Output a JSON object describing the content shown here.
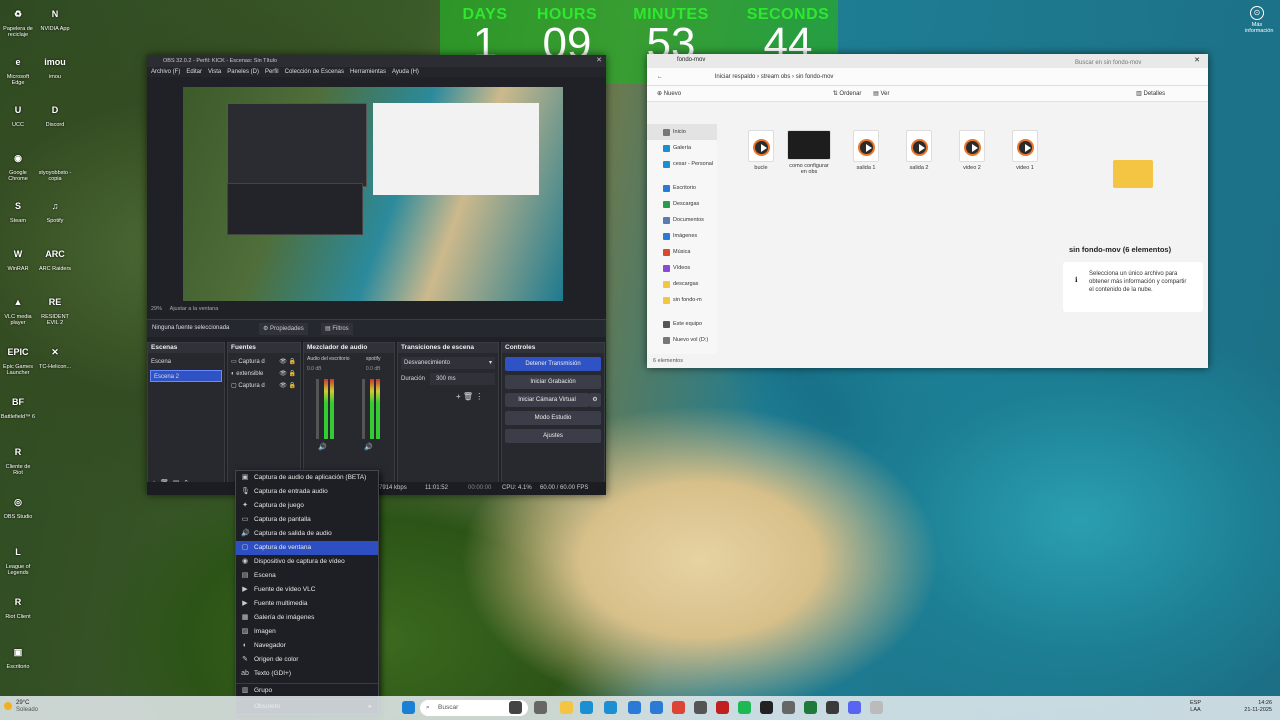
{
  "desktop": {
    "icons": [
      {
        "label": "Papelera de reciclaje",
        "glyph": "♻",
        "color": "#4a90d9"
      },
      {
        "label": "NVIDIA App",
        "glyph": "N",
        "color": "#6bb82d"
      },
      {
        "label": "Microsoft Edge",
        "glyph": "e",
        "color": "#1b8fd2"
      },
      {
        "label": "imou",
        "glyph": "imou",
        "color": "#f39a1e"
      },
      {
        "label": "UCC",
        "glyph": "U",
        "color": "#e05a1c"
      },
      {
        "label": "Discord",
        "glyph": "D",
        "color": "#5865f2"
      },
      {
        "label": "Google Chrome",
        "glyph": "◉",
        "color": "#db4437"
      },
      {
        "label": "styoyobbsto - copia",
        "glyph": "",
        "color": "#f2f2f2"
      },
      {
        "label": "Steam",
        "glyph": "S",
        "color": "#1b2838"
      },
      {
        "label": "Spotify",
        "glyph": "♫",
        "color": "#1db954"
      },
      {
        "label": "WinRAR",
        "glyph": "W",
        "color": "#8a2d8a"
      },
      {
        "label": "ARC Raiders",
        "glyph": "ARC",
        "color": "#222222"
      },
      {
        "label": "VLC media player",
        "glyph": "▲",
        "color": "#f08a00"
      },
      {
        "label": "RESIDENT EVIL 2",
        "glyph": "RE",
        "color": "#3a0d0d"
      },
      {
        "label": "Epic Games Launcher",
        "glyph": "EPIC",
        "color": "#2a2a2a"
      },
      {
        "label": "TC-Helicon...",
        "glyph": "✕",
        "color": "#111111"
      },
      {
        "label": "Battlefield™ 6",
        "glyph": "BF",
        "color": "#8a4a2a"
      },
      {
        "label": "Cliente de Riot",
        "glyph": "R",
        "color": "#d13639"
      },
      {
        "label": "OBS Studio",
        "glyph": "◎",
        "color": "#302e31"
      },
      {
        "label": "League of Legends",
        "glyph": "L",
        "color": "#c89b3c"
      },
      {
        "label": "Riot Client",
        "glyph": "R",
        "color": "#d13639"
      },
      {
        "label": "Escritorio",
        "glyph": "▣",
        "color": "#5a7ab0"
      }
    ],
    "top_right_icon_label": "Más información"
  },
  "timer": {
    "labels": [
      "DAYS",
      "HOURS",
      "MINUTES",
      "SECONDS"
    ],
    "values": [
      "1",
      "09",
      "53",
      "44"
    ]
  },
  "obs": {
    "title": "OBS 32.0.2 - Perfil: KICK - Escenas: Sin Título",
    "menu": [
      "Archivo (F)",
      "Editar",
      "Vista",
      "Paneles (D)",
      "Perfil",
      "Colección de Escenas",
      "Herramientas",
      "Ayuda (H)"
    ],
    "zoom_label": "29%",
    "fit_label": "Ajustar a la ventana",
    "no_source": "Ninguna fuente seleccionada",
    "properties_btn": "Propiedades",
    "filters_btn": "Filtros",
    "panels": {
      "scenes": {
        "title": "Escenas",
        "items": [
          "Escena",
          "Escena 2"
        ],
        "selected": 1
      },
      "sources": {
        "title": "Fuentes",
        "items": [
          "Captura d",
          "extensible",
          "Captura d"
        ]
      },
      "mixer": {
        "title": "Mezclador de audio",
        "channels": [
          {
            "name": "Audio del escritorio",
            "db": "0.0 dB"
          },
          {
            "name": "spotify",
            "db": "0.0 dB"
          }
        ]
      },
      "transitions": {
        "title": "Transiciones de escena",
        "type": "Desvanecimiento",
        "duration_label": "Duración",
        "duration_value": "300 ms"
      },
      "controls": {
        "title": "Controles",
        "buttons": [
          "Detener Transmisión",
          "Iniciar Grabación",
          "Iniciar Cámara Virtual",
          "Modo Estudio",
          "Ajustes"
        ]
      }
    },
    "status": {
      "bitrate": "7914 kbps",
      "live_time": "11:01:52",
      "rec_time": "00:00:00",
      "cpu": "CPU: 4.1%",
      "fps": "60.00 / 60.00 FPS"
    }
  },
  "context_menu": {
    "items": [
      {
        "label": "Captura de audio de aplicación (BETA)",
        "icon": "▣"
      },
      {
        "label": "Captura de entrada audio",
        "icon": "🎙"
      },
      {
        "label": "Captura de juego",
        "icon": "✦"
      },
      {
        "label": "Captura de pantalla",
        "icon": "▭"
      },
      {
        "label": "Captura de salida de audio",
        "icon": "🔊"
      },
      {
        "label": "Captura de ventana",
        "icon": "▢"
      },
      {
        "label": "Dispositivo de captura de vídeo",
        "icon": "◉"
      },
      {
        "label": "Escena",
        "icon": "▤"
      },
      {
        "label": "Fuente de vídeo VLC",
        "icon": "▶"
      },
      {
        "label": "Fuente multimedia",
        "icon": "▶"
      },
      {
        "label": "Galería de imágenes",
        "icon": "▦"
      },
      {
        "label": "Imagen",
        "icon": "▨"
      },
      {
        "label": "Navegador",
        "icon": "◐"
      },
      {
        "label": "Origen de color",
        "icon": "✎"
      },
      {
        "label": "Texto (GDI+)",
        "icon": "ab"
      },
      {
        "label": "Grupo",
        "icon": "▥"
      },
      {
        "label": "Obsoleto",
        "icon": ""
      }
    ],
    "selected_index": 5
  },
  "explorer": {
    "tab": "fondo-mov",
    "breadcrumb": [
      "Iniciar respaldo",
      "stream obs",
      "sin fondo-mov"
    ],
    "search_placeholder": "Buscar en sin fondo-mov",
    "toolbar": {
      "new": "Nuevo",
      "sort": "Ordenar",
      "view": "Ver",
      "details": "Detalles"
    },
    "nav": [
      "Inicio",
      "Galería",
      "cesar - Personal",
      "Escritorio",
      "Descargas",
      "Documentos",
      "Imágenes",
      "Música",
      "Vídeos",
      "descargas",
      "sin fondo-m",
      "Este equipo",
      "Nuevo vol (D:)"
    ],
    "files": [
      "bucle",
      "como configurar en obs",
      "salida 1",
      "salida 2",
      "video 2",
      "video 1"
    ],
    "details_title": "sin fondo-mov (6 elementos)",
    "details_text": "Selecciona un único archivo para obtener más información y compartir el contenido de la nube.",
    "status": "6 elementos"
  },
  "taskbar": {
    "weather_temp": "29°C",
    "weather_text": "Soleado",
    "search_label": "Buscar",
    "lang": "ESP",
    "lang2": "LAA",
    "time": "14:26",
    "date": "21-11-2025"
  }
}
